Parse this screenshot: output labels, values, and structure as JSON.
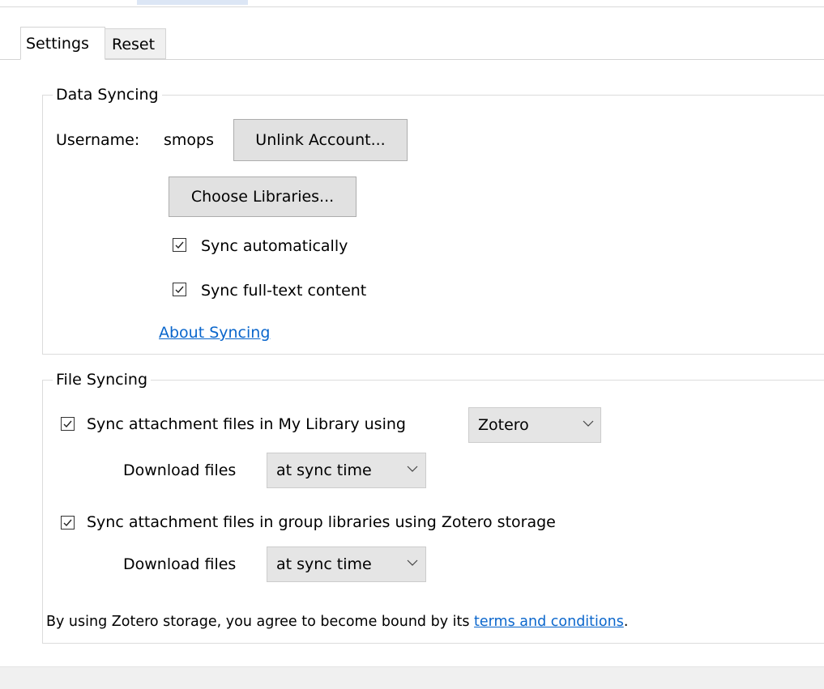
{
  "tabs": [
    {
      "label": "Settings",
      "active": true
    },
    {
      "label": "Reset",
      "active": false
    }
  ],
  "data_syncing": {
    "legend": "Data Syncing",
    "username_label": "Username:",
    "username_value": "smops",
    "unlink_button": "Unlink Account...",
    "choose_libraries_button": "Choose Libraries...",
    "sync_automatically": {
      "label": "Sync automatically",
      "checked": true
    },
    "sync_fulltext": {
      "label": "Sync full-text content",
      "checked": true
    },
    "about_link": "About Syncing"
  },
  "file_syncing": {
    "legend": "File Syncing",
    "my_library": {
      "label": "Sync attachment files in My Library using",
      "checked": true,
      "method_selected": "Zotero",
      "download_label": "Download files",
      "download_selected": "at sync time"
    },
    "group_libraries": {
      "label": "Sync attachment files in group libraries using Zotero storage",
      "checked": true,
      "download_label": "Download files",
      "download_selected": "at sync time"
    },
    "terms_prefix": "By using Zotero storage, you agree to become bound by its ",
    "terms_link": "terms and conditions",
    "terms_suffix": "."
  },
  "colors": {
    "link": "#0a66cc",
    "button_bg": "#e1e1e1",
    "select_bg": "#e5e5e5"
  }
}
